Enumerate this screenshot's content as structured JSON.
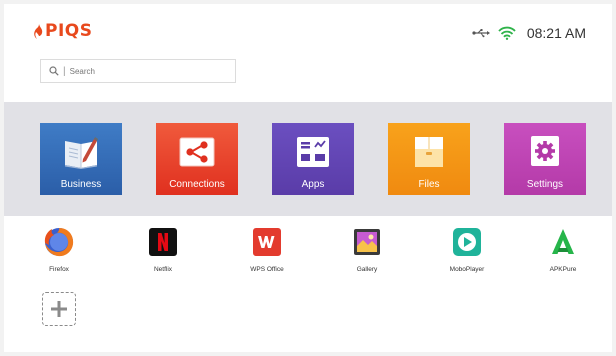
{
  "header": {
    "logo_text": "PIQS",
    "time": "08:21 AM",
    "status_icons": [
      "usb-icon",
      "wifi-icon"
    ]
  },
  "search": {
    "placeholder": "Search"
  },
  "categories": [
    {
      "label": "Business",
      "icon": "business-book-icon",
      "color": "#2f66b0"
    },
    {
      "label": "Connections",
      "icon": "share-icon",
      "color": "#e63b25"
    },
    {
      "label": "Apps",
      "icon": "apps-grid-icon",
      "color": "#5e43b0"
    },
    {
      "label": "Files",
      "icon": "folder-icon",
      "color": "#f29314"
    },
    {
      "label": "Settings",
      "icon": "gear-icon",
      "color": "#bd43b1"
    }
  ],
  "apps": [
    {
      "label": "Firefox",
      "icon": "firefox-icon"
    },
    {
      "label": "Netflix",
      "icon": "netflix-icon"
    },
    {
      "label": "WPS Office",
      "icon": "wps-office-icon"
    },
    {
      "label": "Gallery",
      "icon": "gallery-icon"
    },
    {
      "label": "MoboPlayer",
      "icon": "moboplayer-icon"
    },
    {
      "label": "APKPure",
      "icon": "apkpure-icon"
    }
  ],
  "colors": {
    "brand": "#e8491d",
    "band_background": "#e1e1e6",
    "wifi": "#2fb34a"
  }
}
